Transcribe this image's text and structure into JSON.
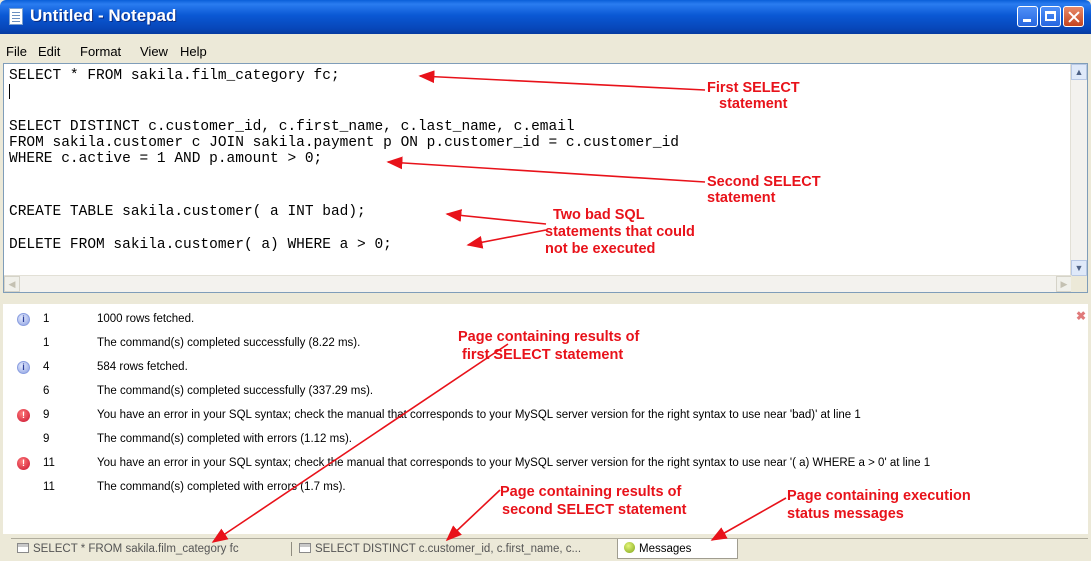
{
  "window": {
    "title": "Untitled - Notepad"
  },
  "menu": [
    "File",
    "Edit",
    "Format",
    "View",
    "Help"
  ],
  "editor": {
    "lines": [
      "SELECT * FROM sakila.film_category fc;",
      "SELECT DISTINCT c.customer_id, c.first_name, c.last_name, c.email",
      "FROM sakila.customer c JOIN sakila.payment p ON p.customer_id = c.customer_id",
      "WHERE c.active = 1 AND p.amount > 0;",
      "CREATE TABLE sakila.customer( a INT bad);",
      "DELETE FROM sakila.customer( a) WHERE a > 0;"
    ]
  },
  "messages": [
    {
      "type": "info",
      "num": "1",
      "text": "1000 rows fetched."
    },
    {
      "type": "none",
      "num": "1",
      "text": "The command(s) completed successfully (8.22 ms)."
    },
    {
      "type": "info",
      "num": "4",
      "text": "584 rows fetched."
    },
    {
      "type": "none",
      "num": "6",
      "text": "The command(s) completed successfully (337.29 ms)."
    },
    {
      "type": "error",
      "num": "9",
      "text": "You have an error in your SQL syntax; check the manual that corresponds to your MySQL server version for the right syntax to use near 'bad)' at line 1"
    },
    {
      "type": "none",
      "num": "9",
      "text": "The command(s) completed with errors (1.12 ms)."
    },
    {
      "type": "error",
      "num": "11",
      "text": "You have an error in your SQL syntax; check the manual that corresponds to your MySQL server version for the right syntax to use near '( a) WHERE a > 0' at line 1"
    },
    {
      "type": "none",
      "num": "11",
      "text": "The command(s) completed with errors (1.7 ms)."
    }
  ],
  "tabs": [
    {
      "label": "SELECT * FROM sakila.film_category fc"
    },
    {
      "label": "SELECT DISTINCT c.customer_id, c.first_name, c..."
    },
    {
      "label": "Messages"
    }
  ],
  "annotations": {
    "first_select": [
      "First SELECT",
      "statement"
    ],
    "second_select": [
      "Second SELECT",
      "statement"
    ],
    "bad_sql": [
      "Two bad SQL",
      "statements that could",
      "not be executed"
    ],
    "page_first": [
      "Page containing results of",
      "first SELECT statement"
    ],
    "page_second": [
      "Page containing results of",
      "second SELECT statement"
    ],
    "page_messages": [
      "Page containing execution",
      "status messages"
    ]
  },
  "colors": {
    "annotation": "#e8121a",
    "titlebar": "#0a58d4"
  }
}
